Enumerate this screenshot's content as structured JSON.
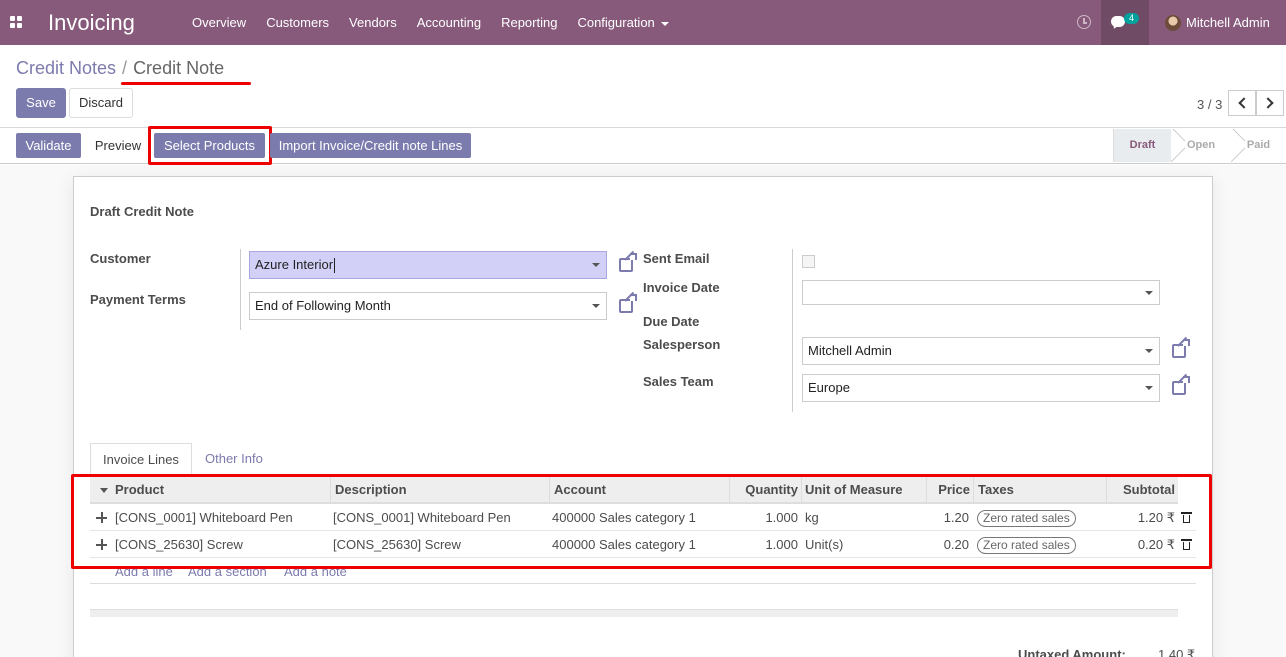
{
  "navbar": {
    "app_title": "Invoicing",
    "menu": [
      {
        "label": "Overview"
      },
      {
        "label": "Customers"
      },
      {
        "label": "Vendors"
      },
      {
        "label": "Accounting"
      },
      {
        "label": "Reporting"
      },
      {
        "label": "Configuration",
        "dropdown": true
      }
    ],
    "chat_badge": "4",
    "user_name": "Mitchell Admin",
    "color": "#875a7b"
  },
  "breadcrumb": {
    "parent": "Credit Notes",
    "separator": "/",
    "current": "Credit Note"
  },
  "actions": {
    "save": "Save",
    "discard": "Discard"
  },
  "pager": {
    "value": "3 / 3"
  },
  "statusbar": {
    "buttons": {
      "validate": "Validate",
      "preview": "Preview",
      "select_products": "Select Products",
      "import_lines": "Import Invoice/Credit note Lines"
    },
    "stages": [
      "Draft",
      "Open",
      "Paid"
    ],
    "active_stage": "Draft"
  },
  "form": {
    "title": "Draft Credit Note",
    "customer": {
      "label": "Customer",
      "value": "Azure Interior"
    },
    "payment_terms": {
      "label": "Payment Terms",
      "value": "End of Following Month"
    },
    "sent_email": {
      "label": "Sent Email",
      "checked": false
    },
    "invoice_date": {
      "label": "Invoice Date",
      "value": ""
    },
    "due_date": {
      "label": "Due Date"
    },
    "salesperson": {
      "label": "Salesperson",
      "value": "Mitchell Admin"
    },
    "sales_team": {
      "label": "Sales Team",
      "value": "Europe"
    }
  },
  "tabs": [
    {
      "label": "Invoice Lines",
      "active": true
    },
    {
      "label": "Other Info",
      "active": false
    }
  ],
  "table": {
    "columns": {
      "product": "Product",
      "description": "Description",
      "account": "Account",
      "quantity": "Quantity",
      "uom": "Unit of Measure",
      "price": "Price",
      "taxes": "Taxes",
      "subtotal": "Subtotal"
    },
    "rows": [
      {
        "product": "[CONS_0001] Whiteboard Pen",
        "description": "[CONS_0001] Whiteboard Pen",
        "account": "400000 Sales category 1",
        "quantity": "1.000",
        "uom": "kg",
        "price": "1.20",
        "taxes": "Zero rated sales",
        "subtotal": "1.20 ₹"
      },
      {
        "product": "[CONS_25630] Screw",
        "description": "[CONS_25630] Screw",
        "account": "400000 Sales category 1",
        "quantity": "1.000",
        "uom": "Unit(s)",
        "price": "0.20",
        "taxes": "Zero rated sales",
        "subtotal": "0.20 ₹"
      }
    ],
    "add_links": {
      "line": "Add a line",
      "section": "Add a section",
      "note": "Add a note"
    }
  },
  "totals": {
    "untaxed_label": "Untaxed Amount:",
    "untaxed_value": "1.40 ₹"
  },
  "highlight_color": "#ee0000"
}
